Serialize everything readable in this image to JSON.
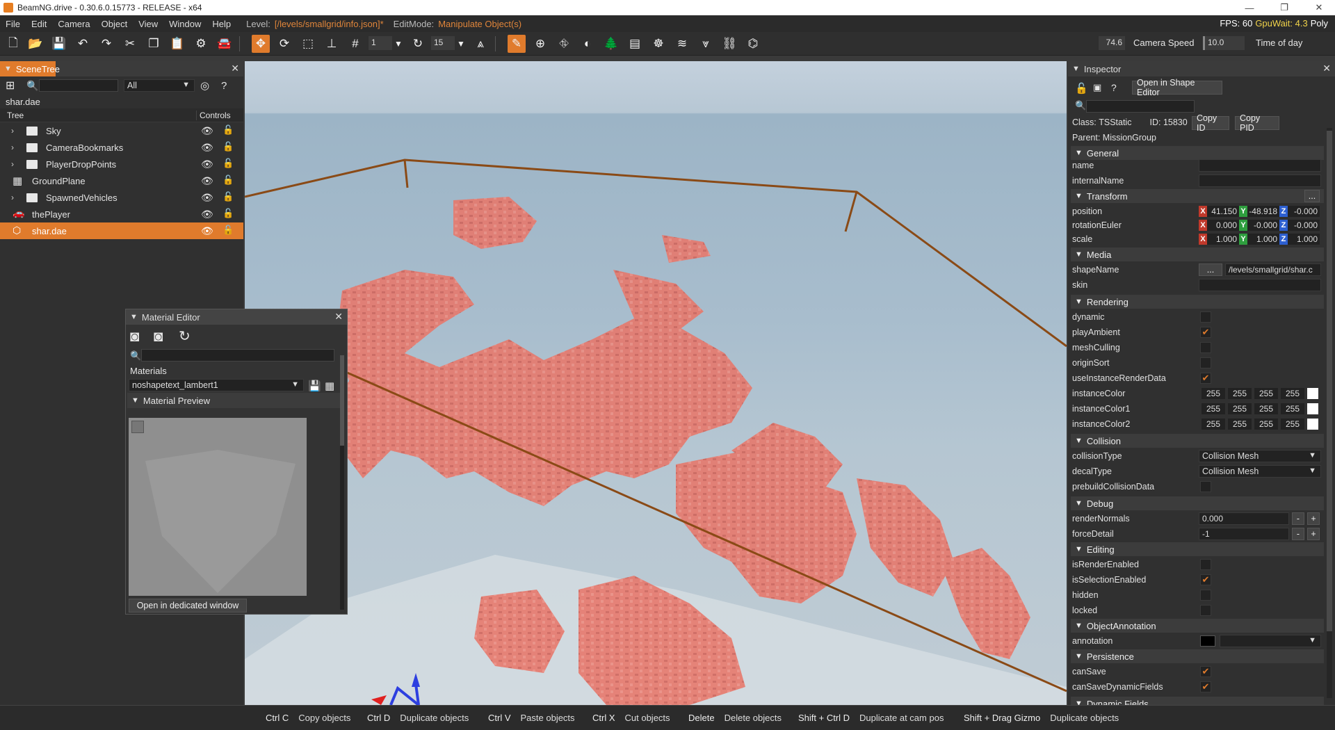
{
  "window": {
    "title": "BeamNG.drive - 0.30.6.0.15773 - RELEASE - x64"
  },
  "menu": {
    "items": [
      "File",
      "Edit",
      "Camera",
      "Object",
      "View",
      "Window",
      "Help"
    ],
    "level_label": "Level:",
    "level_value": "[/levels/smallgrid/info.json]*",
    "editmode_label": "EditMode:",
    "editmode_value": "Manipulate Object(s)",
    "fps": "FPS: 60",
    "gpuwait": "GpuWait: 4.3",
    "poly": "Poly"
  },
  "toolbar": {
    "snap_value": "1",
    "rot_value": "15",
    "fov_value": "74.6",
    "camera_speed_label": "Camera Speed",
    "camera_speed_value": "10.0",
    "time_of_day_label": "Time of day"
  },
  "scenetree": {
    "title": "SceneTree",
    "filter": "All",
    "selected_label": "shar.dae",
    "col_tree": "Tree",
    "col_controls": "Controls",
    "rows": [
      {
        "name": "Sky",
        "type": "folder",
        "expand": true
      },
      {
        "name": "CameraBookmarks",
        "type": "folder",
        "expand": true
      },
      {
        "name": "PlayerDropPoints",
        "type": "folder",
        "expand": true
      },
      {
        "name": "GroundPlane",
        "type": "grid",
        "expand": false
      },
      {
        "name": "SpawnedVehicles",
        "type": "folder",
        "expand": true
      },
      {
        "name": "thePlayer",
        "type": "car",
        "expand": false
      },
      {
        "name": "shar.dae",
        "type": "mesh",
        "expand": false,
        "selected": true
      }
    ]
  },
  "material_editor": {
    "title": "Material Editor",
    "materials_label": "Materials",
    "material_value": "noshapetext_lambert1",
    "preview_label": "Material Preview",
    "open_button": "Open in dedicated window"
  },
  "inspector": {
    "title": "Inspector",
    "open_shape_editor": "Open in Shape Editor",
    "class_label": "Class:",
    "class_value": "TSStatic",
    "id_label": "ID:",
    "id_value": "15830",
    "copy_id": "Copy ID",
    "copy_pid": "Copy PID",
    "parent_label": "Parent:",
    "parent_value": "MissionGroup",
    "sections": {
      "general": "General",
      "transform": "Transform",
      "media": "Media",
      "rendering": "Rendering",
      "collision": "Collision",
      "debug": "Debug",
      "editing": "Editing",
      "annotation": "ObjectAnnotation",
      "persistence": "Persistence",
      "dynamic": "Dynamic Fields"
    },
    "fields": {
      "name": "name",
      "internalName": "internalName",
      "position": "position",
      "rotationEuler": "rotationEuler",
      "scale": "scale",
      "shapeName": "shapeName",
      "shapeName_value": "/levels/smallgrid/shar.c",
      "skin": "skin",
      "dynamic": "dynamic",
      "playAmbient": "playAmbient",
      "meshCulling": "meshCulling",
      "originSort": "originSort",
      "useInstanceRenderData": "useInstanceRenderData",
      "instanceColor": "instanceColor",
      "instanceColor1": "instanceColor1",
      "instanceColor2": "instanceColor2",
      "collisionType": "collisionType",
      "collisionType_value": "Collision Mesh",
      "decalType": "decalType",
      "decalType_value": "Collision Mesh",
      "prebuildCollisionData": "prebuildCollisionData",
      "renderNormals": "renderNormals",
      "renderNormals_value": "0.000",
      "forceDetail": "forceDetail",
      "forceDetail_value": "-1",
      "isRenderEnabled": "isRenderEnabled",
      "isSelectionEnabled": "isSelectionEnabled",
      "hidden": "hidden",
      "locked": "locked",
      "annotation": "annotation",
      "canSave": "canSave",
      "canSaveDynamicFields": "canSaveDynamicFields"
    },
    "position": {
      "x": "41.150",
      "y": "-48.918",
      "z": "-0.000"
    },
    "rotation": {
      "x": "0.000",
      "y": "-0.000",
      "z": "-0.000"
    },
    "scale": {
      "x": "1.000",
      "y": "1.000",
      "z": "1.000"
    },
    "color_value": "255",
    "axis_labels": {
      "x": "X",
      "y": "Y",
      "z": "Z"
    },
    "minus": "-",
    "plus": "+",
    "ellipsis": "...",
    "check_mark": "✔"
  },
  "statusbar": {
    "shortcuts": [
      {
        "key": "Ctrl C",
        "label": "Copy objects"
      },
      {
        "key": "Ctrl D",
        "label": "Duplicate objects"
      },
      {
        "key": "Ctrl V",
        "label": "Paste objects"
      },
      {
        "key": "Ctrl X",
        "label": "Cut objects"
      },
      {
        "key": "Delete",
        "label": "Delete objects"
      },
      {
        "key": "Shift + Ctrl D",
        "label": "Duplicate at cam pos"
      },
      {
        "key": "Shift + Drag Gizmo",
        "label": "Duplicate objects"
      }
    ]
  },
  "colors": {
    "accent": "#e07b2c",
    "city": "#e8776a",
    "selection_box": "#8a4a16"
  }
}
